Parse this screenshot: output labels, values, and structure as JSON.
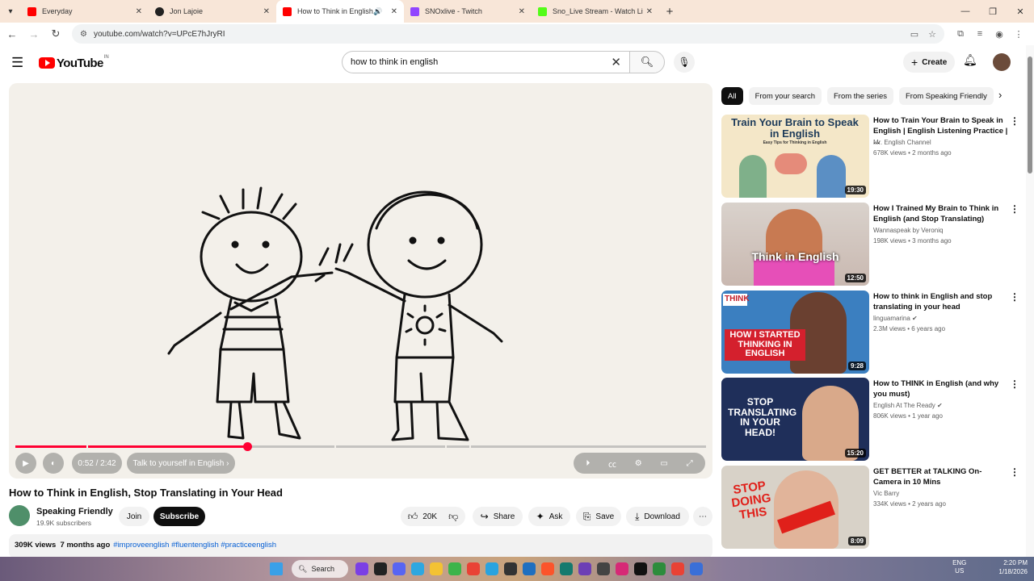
{
  "browser": {
    "tabs": [
      {
        "title": "Everyday",
        "color": "#ff0000"
      },
      {
        "title": "Jon Lajoie",
        "color": "#222222"
      },
      {
        "title": "How to Think in English, Sto",
        "color": "#ff0000"
      },
      {
        "title": "SNOxlive - Twitch",
        "color": "#9146ff"
      },
      {
        "title": "Sno_Live Stream - Watch Live o",
        "color": "#53fc18"
      }
    ],
    "url": "youtube.com/watch?v=UPcE7hJryRI"
  },
  "youtube": {
    "logo_text": "YouTube",
    "logo_country": "IN",
    "search_query": "how to think in english",
    "create_label": "Create"
  },
  "player": {
    "time": "0:52 / 2:42",
    "chapter": "Talk to yourself in English",
    "chapter_arrow": "›",
    "progress": 0.33
  },
  "video": {
    "title": "How to Think in English, Stop Translating in Your Head",
    "channel": "Speaking Friendly",
    "subscribers": "19.9K subscribers",
    "join_label": "Join",
    "subscribe_label": "Subscribe",
    "likes": "20K",
    "share_label": "Share",
    "ask_label": "Ask",
    "save_label": "Save",
    "download_label": "Download",
    "views": "309K views",
    "age": "7 months ago",
    "tags": "#improveenglish #fluentenglish #practiceenglish"
  },
  "chips": [
    "All",
    "From your search",
    "From the series",
    "From Speaking Friendly"
  ],
  "recommendations": [
    {
      "title": "How to Train Your Brain to Speak in English | English Listening Practice | ...",
      "channel": "Mr. English Channel",
      "stats": "678K views • 2 months ago",
      "duration": "19:30",
      "thumb_text": "Train Your Brain to Speak in English",
      "thumb_sub": "Easy Tips for Thinking in English"
    },
    {
      "title": "How I Trained My Brain to Think in English (and Stop Translating)",
      "channel": "Wannaspeak by Veroniq",
      "stats": "198K views • 3 months ago",
      "duration": "12:50",
      "thumb_text": "Think in English"
    },
    {
      "title": "How to think in English and stop translating in your head",
      "channel": "linguamarina",
      "stats": "2.3M views • 6 years ago",
      "duration": "9:28",
      "thumb_text": "HOW I STARTED THINKING IN ENGLISH",
      "thumb_sub": "THINK"
    },
    {
      "title": "How to THINK in English (and why you must)",
      "channel": "English At The Ready",
      "stats": "806K views • 1 year ago",
      "duration": "15:20",
      "thumb_text": "STOP TRANSLATING IN YOUR HEAD!"
    },
    {
      "title": "GET BETTER at TALKING On-Camera in 10 Mins",
      "channel": "Vic Barry",
      "stats": "334K views • 2 years ago",
      "duration": "8:09",
      "thumb_text": "STOP DOING THIS"
    }
  ],
  "taskbar": {
    "search_label": "Search",
    "lang_line1": "ENG",
    "lang_line2": "US",
    "time": "2:20 PM",
    "date": "1/18/2026"
  }
}
